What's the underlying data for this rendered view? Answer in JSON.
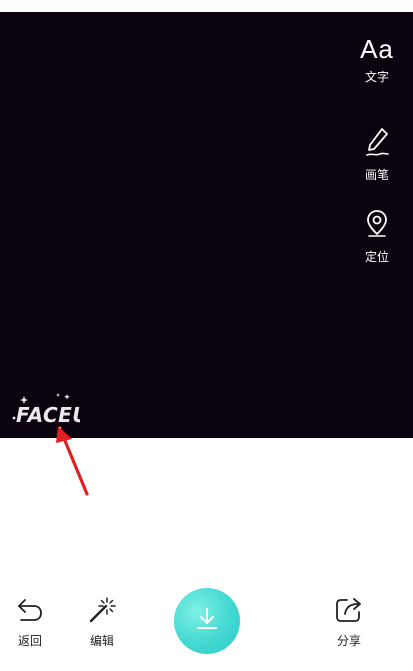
{
  "tools": {
    "text_glyph": "Aa",
    "text_label": "文字",
    "pen_label": "画笔",
    "location_label": "定位"
  },
  "watermark": {
    "logo_text": "FACEU"
  },
  "bottom_bar": {
    "back_label": "返回",
    "edit_label": "编辑",
    "share_label": "分享",
    "save_icon": "download-icon"
  },
  "colors": {
    "preview_background": "#0b040e",
    "save_button": "#43d8d2",
    "annotation_arrow": "#e02020"
  }
}
